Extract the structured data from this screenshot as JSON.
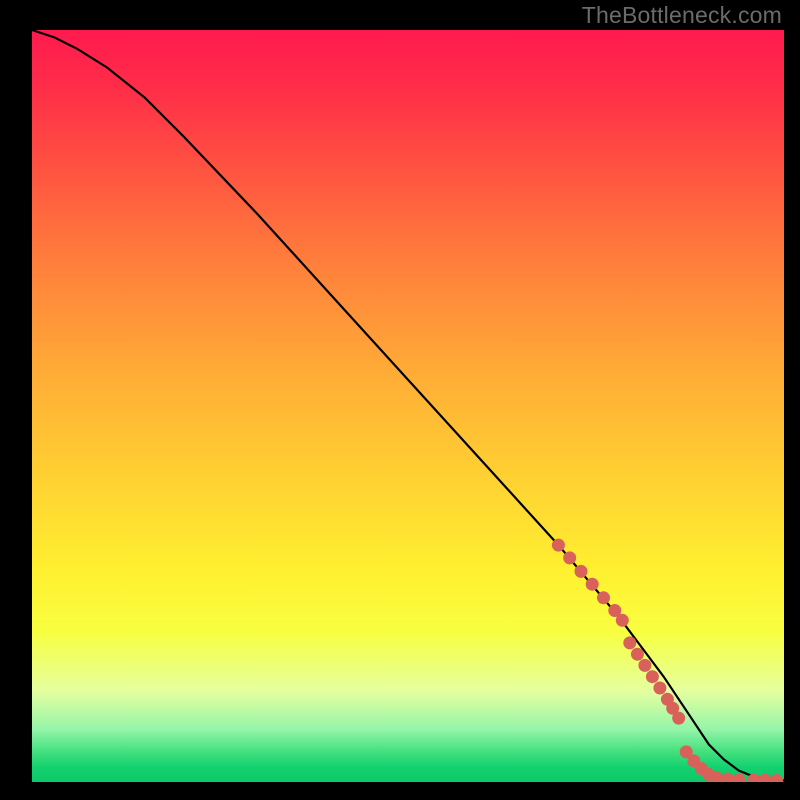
{
  "watermark": "TheBottleneck.com",
  "chart_data": {
    "type": "line",
    "title": "",
    "xlabel": "",
    "ylabel": "",
    "xlim": [
      0,
      100
    ],
    "ylim": [
      0,
      100
    ],
    "series": [
      {
        "name": "curve",
        "x": [
          0,
          3,
          6,
          10,
          15,
          20,
          30,
          40,
          50,
          60,
          70,
          78,
          84,
          88,
          90,
          92,
          94,
          96,
          98,
          100
        ],
        "y": [
          100,
          99,
          97.5,
          95,
          91,
          86,
          75.5,
          64.5,
          53.5,
          42.5,
          31.5,
          22,
          14,
          8,
          5,
          3,
          1.5,
          0.7,
          0.3,
          0.2
        ]
      }
    ],
    "markers": [
      {
        "x": 70.0,
        "y": 31.5
      },
      {
        "x": 71.5,
        "y": 29.8
      },
      {
        "x": 73.0,
        "y": 28.0
      },
      {
        "x": 74.5,
        "y": 26.3
      },
      {
        "x": 76.0,
        "y": 24.5
      },
      {
        "x": 77.5,
        "y": 22.8
      },
      {
        "x": 78.5,
        "y": 21.5
      },
      {
        "x": 79.5,
        "y": 18.5
      },
      {
        "x": 80.5,
        "y": 17.0
      },
      {
        "x": 81.5,
        "y": 15.5
      },
      {
        "x": 82.5,
        "y": 14.0
      },
      {
        "x": 83.5,
        "y": 12.5
      },
      {
        "x": 84.5,
        "y": 11.0
      },
      {
        "x": 85.2,
        "y": 9.8
      },
      {
        "x": 86.0,
        "y": 8.5
      },
      {
        "x": 87.0,
        "y": 4.0
      },
      {
        "x": 88.0,
        "y": 2.8
      },
      {
        "x": 89.0,
        "y": 1.8
      },
      {
        "x": 90.0,
        "y": 1.0
      },
      {
        "x": 91.0,
        "y": 0.6
      },
      {
        "x": 92.5,
        "y": 0.4
      },
      {
        "x": 94.0,
        "y": 0.3
      },
      {
        "x": 96.0,
        "y": 0.25
      },
      {
        "x": 97.5,
        "y": 0.22
      },
      {
        "x": 99.0,
        "y": 0.2
      }
    ],
    "marker_radius_px": 6.5
  }
}
